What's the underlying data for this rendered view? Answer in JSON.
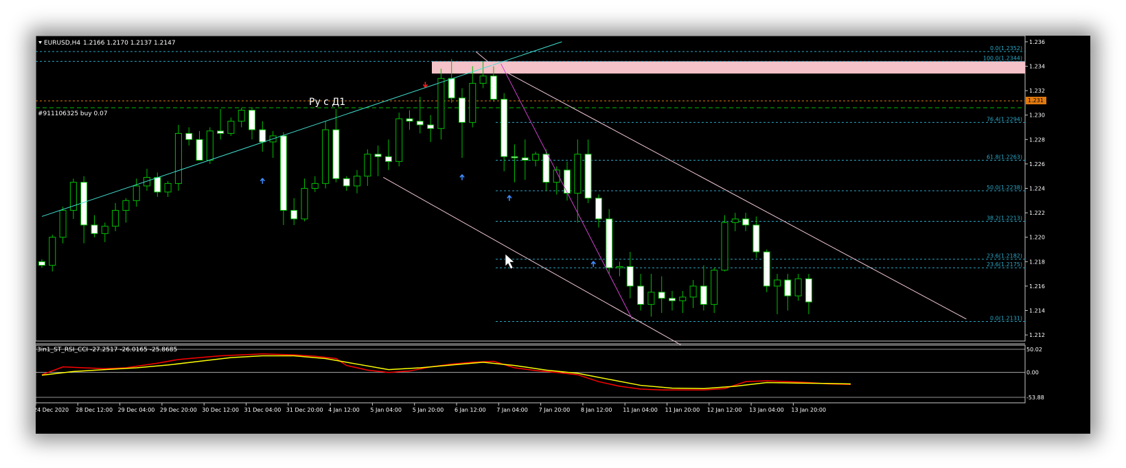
{
  "header": {
    "symbol_label": "EURUSD,H4",
    "ohlc": "1.2166 1.2170 1.2137 1.2147"
  },
  "position_label": "#911106325 buy 0.07",
  "annotation": "Ру с Д1",
  "indicator": {
    "label": "3in1_ST_RSI_CCI -27.2517 -26.0165 -25.8685",
    "axis_labels": [
      "50.02",
      "0.00",
      "-53.88"
    ]
  },
  "colors": {
    "background": "#000000",
    "bull_candle": "#000000",
    "bear_candle": "#ffffff",
    "wick": "#00c000",
    "fib": "#2aa8c8",
    "zone": "#f4c2c8",
    "price_tag": "#e07a10",
    "osc_red": "#ff0000",
    "osc_yellow": "#ffff00"
  },
  "chart_data": {
    "type": "candlestick",
    "ylim": [
      1.2115,
      1.2365
    ],
    "y_ticks": [
      "1.236",
      "1.234",
      "1.232",
      "1.230",
      "1.228",
      "1.226",
      "1.224",
      "1.222",
      "1.220",
      "1.218",
      "1.216",
      "1.214",
      "1.212"
    ],
    "current_price_tag": "1.231",
    "x_labels": [
      "24 Dec 2020",
      "28 Dec 12:00",
      "29 Dec 04:00",
      "29 Dec 20:00",
      "30 Dec 12:00",
      "31 Dec 04:00",
      "31 Dec 20:00",
      "4 Jan 12:00",
      "5 Jan 04:00",
      "5 Jan 20:00",
      "6 Jan 12:00",
      "7 Jan 04:00",
      "7 Jan 20:00",
      "8 Jan 12:00",
      "11 Jan 04:00",
      "11 Jan 20:00",
      "12 Jan 12:00",
      "13 Jan 04:00",
      "13 Jan 20:00"
    ],
    "fib_levels": [
      {
        "label": "0.0(1.2352)",
        "price": 1.2352
      },
      {
        "label": "100.0(1.2344)",
        "price": 1.2344
      },
      {
        "label": "76.4(1.2294)",
        "price": 1.2294
      },
      {
        "label": "61.8(1.2263)",
        "price": 1.2263
      },
      {
        "label": "50.0(1.2238)",
        "price": 1.2238
      },
      {
        "label": "38.2(1.2213)",
        "price": 1.2213
      },
      {
        "label": "23.6(1.2182)",
        "price": 1.2182
      },
      {
        "label": "23.6(1.2175)",
        "price": 1.2175
      },
      {
        "label": "0.0(1.2131)",
        "price": 1.2131
      }
    ],
    "position_price": 1.2306,
    "zone": [
      1.2334,
      1.2344
    ],
    "candles": [
      [
        1.218,
        1.2182,
        1.2175,
        1.2177
      ],
      [
        1.2177,
        1.2202,
        1.2172,
        1.22
      ],
      [
        1.22,
        1.2225,
        1.2195,
        1.2222
      ],
      [
        1.2222,
        1.2248,
        1.2215,
        1.2245
      ],
      [
        1.2245,
        1.225,
        1.2195,
        1.221
      ],
      [
        1.221,
        1.2218,
        1.22,
        1.2203
      ],
      [
        1.2203,
        1.2212,
        1.2196,
        1.2209
      ],
      [
        1.2209,
        1.2228,
        1.2205,
        1.2222
      ],
      [
        1.2222,
        1.2232,
        1.2212,
        1.223
      ],
      [
        1.223,
        1.2248,
        1.2225,
        1.2242
      ],
      [
        1.2242,
        1.2256,
        1.2238,
        1.2249
      ],
      [
        1.2249,
        1.2253,
        1.2233,
        1.2237
      ],
      [
        1.2237,
        1.2246,
        1.2233,
        1.2244
      ],
      [
        1.2244,
        1.2292,
        1.2238,
        1.2285
      ],
      [
        1.2285,
        1.229,
        1.2275,
        1.228
      ],
      [
        1.228,
        1.2287,
        1.2268,
        1.2263
      ],
      [
        1.2263,
        1.229,
        1.226,
        1.2287
      ],
      [
        1.2287,
        1.2305,
        1.228,
        1.2285
      ],
      [
        1.2285,
        1.2298,
        1.2283,
        1.2295
      ],
      [
        1.2295,
        1.2306,
        1.229,
        1.2304
      ],
      [
        1.2304,
        1.2306,
        1.228,
        1.2288
      ],
      [
        1.2288,
        1.2295,
        1.227,
        1.2278
      ],
      [
        1.2278,
        1.2287,
        1.2265,
        1.2283
      ],
      [
        1.2283,
        1.2286,
        1.221,
        1.2222
      ],
      [
        1.2222,
        1.2232,
        1.221,
        1.2215
      ],
      [
        1.2215,
        1.2248,
        1.2213,
        1.224
      ],
      [
        1.224,
        1.225,
        1.2237,
        1.2244
      ],
      [
        1.2244,
        1.2295,
        1.224,
        1.2288
      ],
      [
        1.2288,
        1.2305,
        1.2245,
        1.2248
      ],
      [
        1.2248,
        1.225,
        1.2238,
        1.2242
      ],
      [
        1.2242,
        1.2255,
        1.2236,
        1.225
      ],
      [
        1.225,
        1.2272,
        1.2242,
        1.2268
      ],
      [
        1.2268,
        1.2275,
        1.225,
        1.2266
      ],
      [
        1.2266,
        1.228,
        1.2255,
        1.2262
      ],
      [
        1.2262,
        1.2302,
        1.2258,
        1.2297
      ],
      [
        1.2297,
        1.2304,
        1.2288,
        1.2295
      ],
      [
        1.2295,
        1.2315,
        1.2285,
        1.2292
      ],
      [
        1.2292,
        1.23,
        1.2278,
        1.2289
      ],
      [
        1.2289,
        1.2338,
        1.228,
        1.233
      ],
      [
        1.233,
        1.2346,
        1.231,
        1.2314
      ],
      [
        1.2314,
        1.2322,
        1.2265,
        1.2294
      ],
      [
        1.2294,
        1.234,
        1.229,
        1.2326
      ],
      [
        1.2326,
        1.2344,
        1.2322,
        1.2332
      ],
      [
        1.2332,
        1.234,
        1.2311,
        1.2313
      ],
      [
        1.2313,
        1.2318,
        1.2254,
        1.2266
      ],
      [
        1.2266,
        1.2276,
        1.2245,
        1.2265
      ],
      [
        1.2265,
        1.228,
        1.2247,
        1.2263
      ],
      [
        1.2263,
        1.227,
        1.2258,
        1.2268
      ],
      [
        1.2268,
        1.2272,
        1.2238,
        1.2245
      ],
      [
        1.2245,
        1.2258,
        1.2235,
        1.2255
      ],
      [
        1.2255,
        1.2262,
        1.223,
        1.2236
      ],
      [
        1.2236,
        1.228,
        1.2212,
        1.2268
      ],
      [
        1.2268,
        1.228,
        1.2228,
        1.2232
      ],
      [
        1.2232,
        1.2235,
        1.2208,
        1.2215
      ],
      [
        1.2215,
        1.2223,
        1.217,
        1.2175
      ],
      [
        1.2175,
        1.218,
        1.2168,
        1.2176
      ],
      [
        1.2176,
        1.2188,
        1.215,
        1.216
      ],
      [
        1.216,
        1.217,
        1.214,
        1.2145
      ],
      [
        1.2145,
        1.217,
        1.2135,
        1.2155
      ],
      [
        1.2155,
        1.2168,
        1.2138,
        1.215
      ],
      [
        1.215,
        1.2156,
        1.214,
        1.2148
      ],
      [
        1.2148,
        1.2156,
        1.2138,
        1.2151
      ],
      [
        1.2151,
        1.2165,
        1.2142,
        1.216
      ],
      [
        1.216,
        1.2177,
        1.214,
        1.2145
      ],
      [
        1.2145,
        1.2175,
        1.2138,
        1.2173
      ],
      [
        1.2173,
        1.2218,
        1.2172,
        1.2212
      ],
      [
        1.2212,
        1.222,
        1.2205,
        1.2215
      ],
      [
        1.2215,
        1.222,
        1.2205,
        1.221
      ],
      [
        1.221,
        1.2217,
        1.2183,
        1.2188
      ],
      [
        1.2188,
        1.219,
        1.2155,
        1.216
      ],
      [
        1.216,
        1.217,
        1.2137,
        1.2165
      ],
      [
        1.2165,
        1.217,
        1.214,
        1.2152
      ],
      [
        1.2152,
        1.217,
        1.2148,
        1.2166
      ],
      [
        1.2166,
        1.217,
        1.2137,
        1.2147
      ]
    ],
    "trendlines": [
      {
        "name": "rising-trendline",
        "color": "#40e0d0",
        "from": [
          0,
          1.2217
        ],
        "to": [
          49.5,
          1.236
        ]
      },
      {
        "name": "upper-channel",
        "color": "#f0c8d8",
        "from": [
          44,
          1.2336
        ],
        "to": [
          88,
          1.2133
        ]
      },
      {
        "name": "lower-channel",
        "color": "#f0c8d8",
        "from": [
          32.5,
          1.2249
        ],
        "to": [
          60.8,
          1.2112
        ]
      },
      {
        "name": "magenta-line",
        "color": "#d040d0",
        "from": [
          43.7,
          1.2342
        ],
        "to": [
          56.2,
          1.2133
        ]
      },
      {
        "name": "short-line",
        "color": "#f0c8d8",
        "from": [
          41.3,
          1.2352
        ],
        "to": [
          43,
          1.234
        ]
      }
    ],
    "up_arrows": [
      [
        21,
        1.2246
      ],
      [
        40,
        1.2249
      ],
      [
        44.5,
        1.2232
      ],
      [
        52.5,
        1.2178
      ]
    ],
    "down_arrows": [
      [
        36.5,
        1.2325
      ]
    ],
    "indicator": {
      "ylim": [
        -53.88,
        50.02
      ],
      "red": [
        [
          0,
          -5
        ],
        [
          2,
          12
        ],
        [
          4,
          10
        ],
        [
          6,
          8
        ],
        [
          8,
          10
        ],
        [
          11,
          20
        ],
        [
          13,
          28
        ],
        [
          15,
          32
        ],
        [
          17,
          36
        ],
        [
          19,
          38
        ],
        [
          21,
          40
        ],
        [
          24,
          38
        ],
        [
          26,
          35
        ],
        [
          28,
          30
        ],
        [
          29,
          15
        ],
        [
          31,
          5
        ],
        [
          33,
          0
        ],
        [
          35,
          3
        ],
        [
          37,
          12
        ],
        [
          39,
          18
        ],
        [
          41,
          22
        ],
        [
          43,
          24
        ],
        [
          45,
          10
        ],
        [
          47,
          4
        ],
        [
          49,
          0
        ],
        [
          51,
          -5
        ],
        [
          53,
          -20
        ],
        [
          55,
          -30
        ],
        [
          57,
          -36
        ],
        [
          59,
          -38
        ],
        [
          61,
          -38
        ],
        [
          63,
          -38
        ],
        [
          65,
          -35
        ],
        [
          67,
          -20
        ],
        [
          69,
          -18
        ],
        [
          71,
          -20
        ],
        [
          73,
          -22
        ],
        [
          75,
          -25
        ],
        [
          77,
          -26
        ]
      ],
      "yellow": [
        [
          0,
          -6
        ],
        [
          3,
          2
        ],
        [
          6,
          6
        ],
        [
          9,
          10
        ],
        [
          12,
          16
        ],
        [
          15,
          24
        ],
        [
          18,
          32
        ],
        [
          21,
          36
        ],
        [
          24,
          36
        ],
        [
          27,
          30
        ],
        [
          30,
          18
        ],
        [
          33,
          6
        ],
        [
          36,
          10
        ],
        [
          39,
          16
        ],
        [
          42,
          22
        ],
        [
          45,
          15
        ],
        [
          48,
          5
        ],
        [
          51,
          -2
        ],
        [
          54,
          -15
        ],
        [
          57,
          -28
        ],
        [
          60,
          -34
        ],
        [
          63,
          -35
        ],
        [
          66,
          -30
        ],
        [
          69,
          -22
        ],
        [
          72,
          -23
        ],
        [
          75,
          -24
        ],
        [
          77,
          -25
        ]
      ]
    }
  }
}
